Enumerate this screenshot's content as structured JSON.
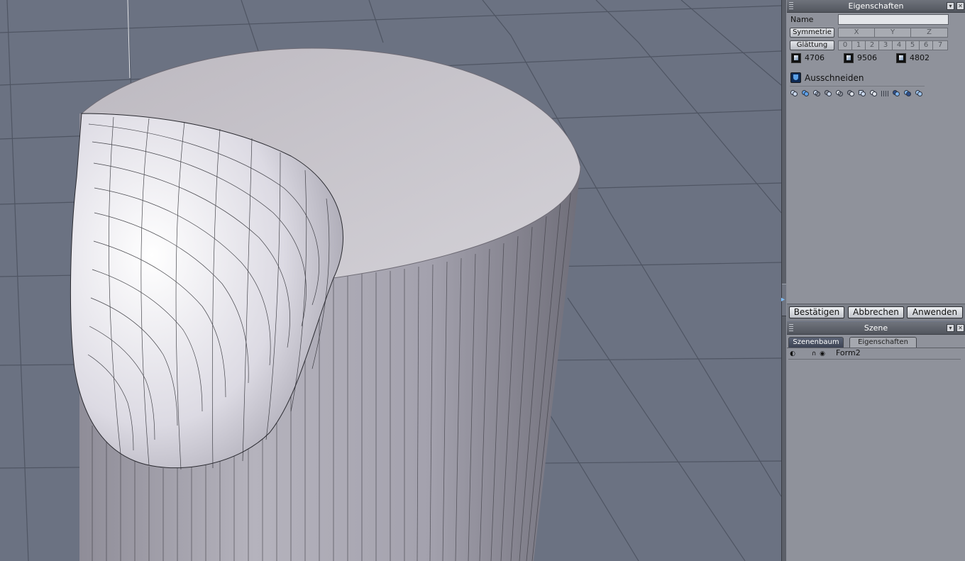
{
  "viewport": {
    "background": "#6b7282",
    "grid_color": "#4c5260",
    "object_color": "#c8c6cc",
    "wire_color": "#2a2a30"
  },
  "properties_panel": {
    "title": "Eigenschaften",
    "name_label": "Name",
    "name_value": "",
    "symmetry_label": "Symmetrie",
    "axes": [
      "X",
      "Y",
      "Z"
    ],
    "smoothing_label": "Glättung",
    "smoothing_levels": [
      "0",
      "1",
      "2",
      "3",
      "4",
      "5",
      "6",
      "7"
    ],
    "stats": [
      "4706",
      "9506",
      "4802"
    ],
    "stat_icons": [
      "vertices-cube-icon",
      "faces-cube-icon",
      "edges-cube-icon"
    ],
    "operation_label": "Ausschneiden",
    "operation_icon": "shield-icon",
    "tool_icons": [
      "boolean-union-icon",
      "boolean-union-filled-icon",
      "boolean-subtract-icon",
      "boolean-intersect-icon",
      "boolean-split-icon",
      "boolean-cut-icon",
      "boolean-merge-icon",
      "boolean-trim-icon",
      "grid-dots-icon",
      "boolean-a-icon",
      "boolean-b-icon",
      "boolean-ab-icon"
    ],
    "buttons": {
      "confirm": "Bestätigen",
      "cancel": "Abbrechen",
      "apply": "Anwenden"
    }
  },
  "scene_panel": {
    "title": "Szene",
    "tabs": [
      "Szenenbaum",
      "Eigenschaften"
    ],
    "active_tab": "Szenenbaum",
    "items": [
      {
        "name": "Form2"
      }
    ]
  }
}
